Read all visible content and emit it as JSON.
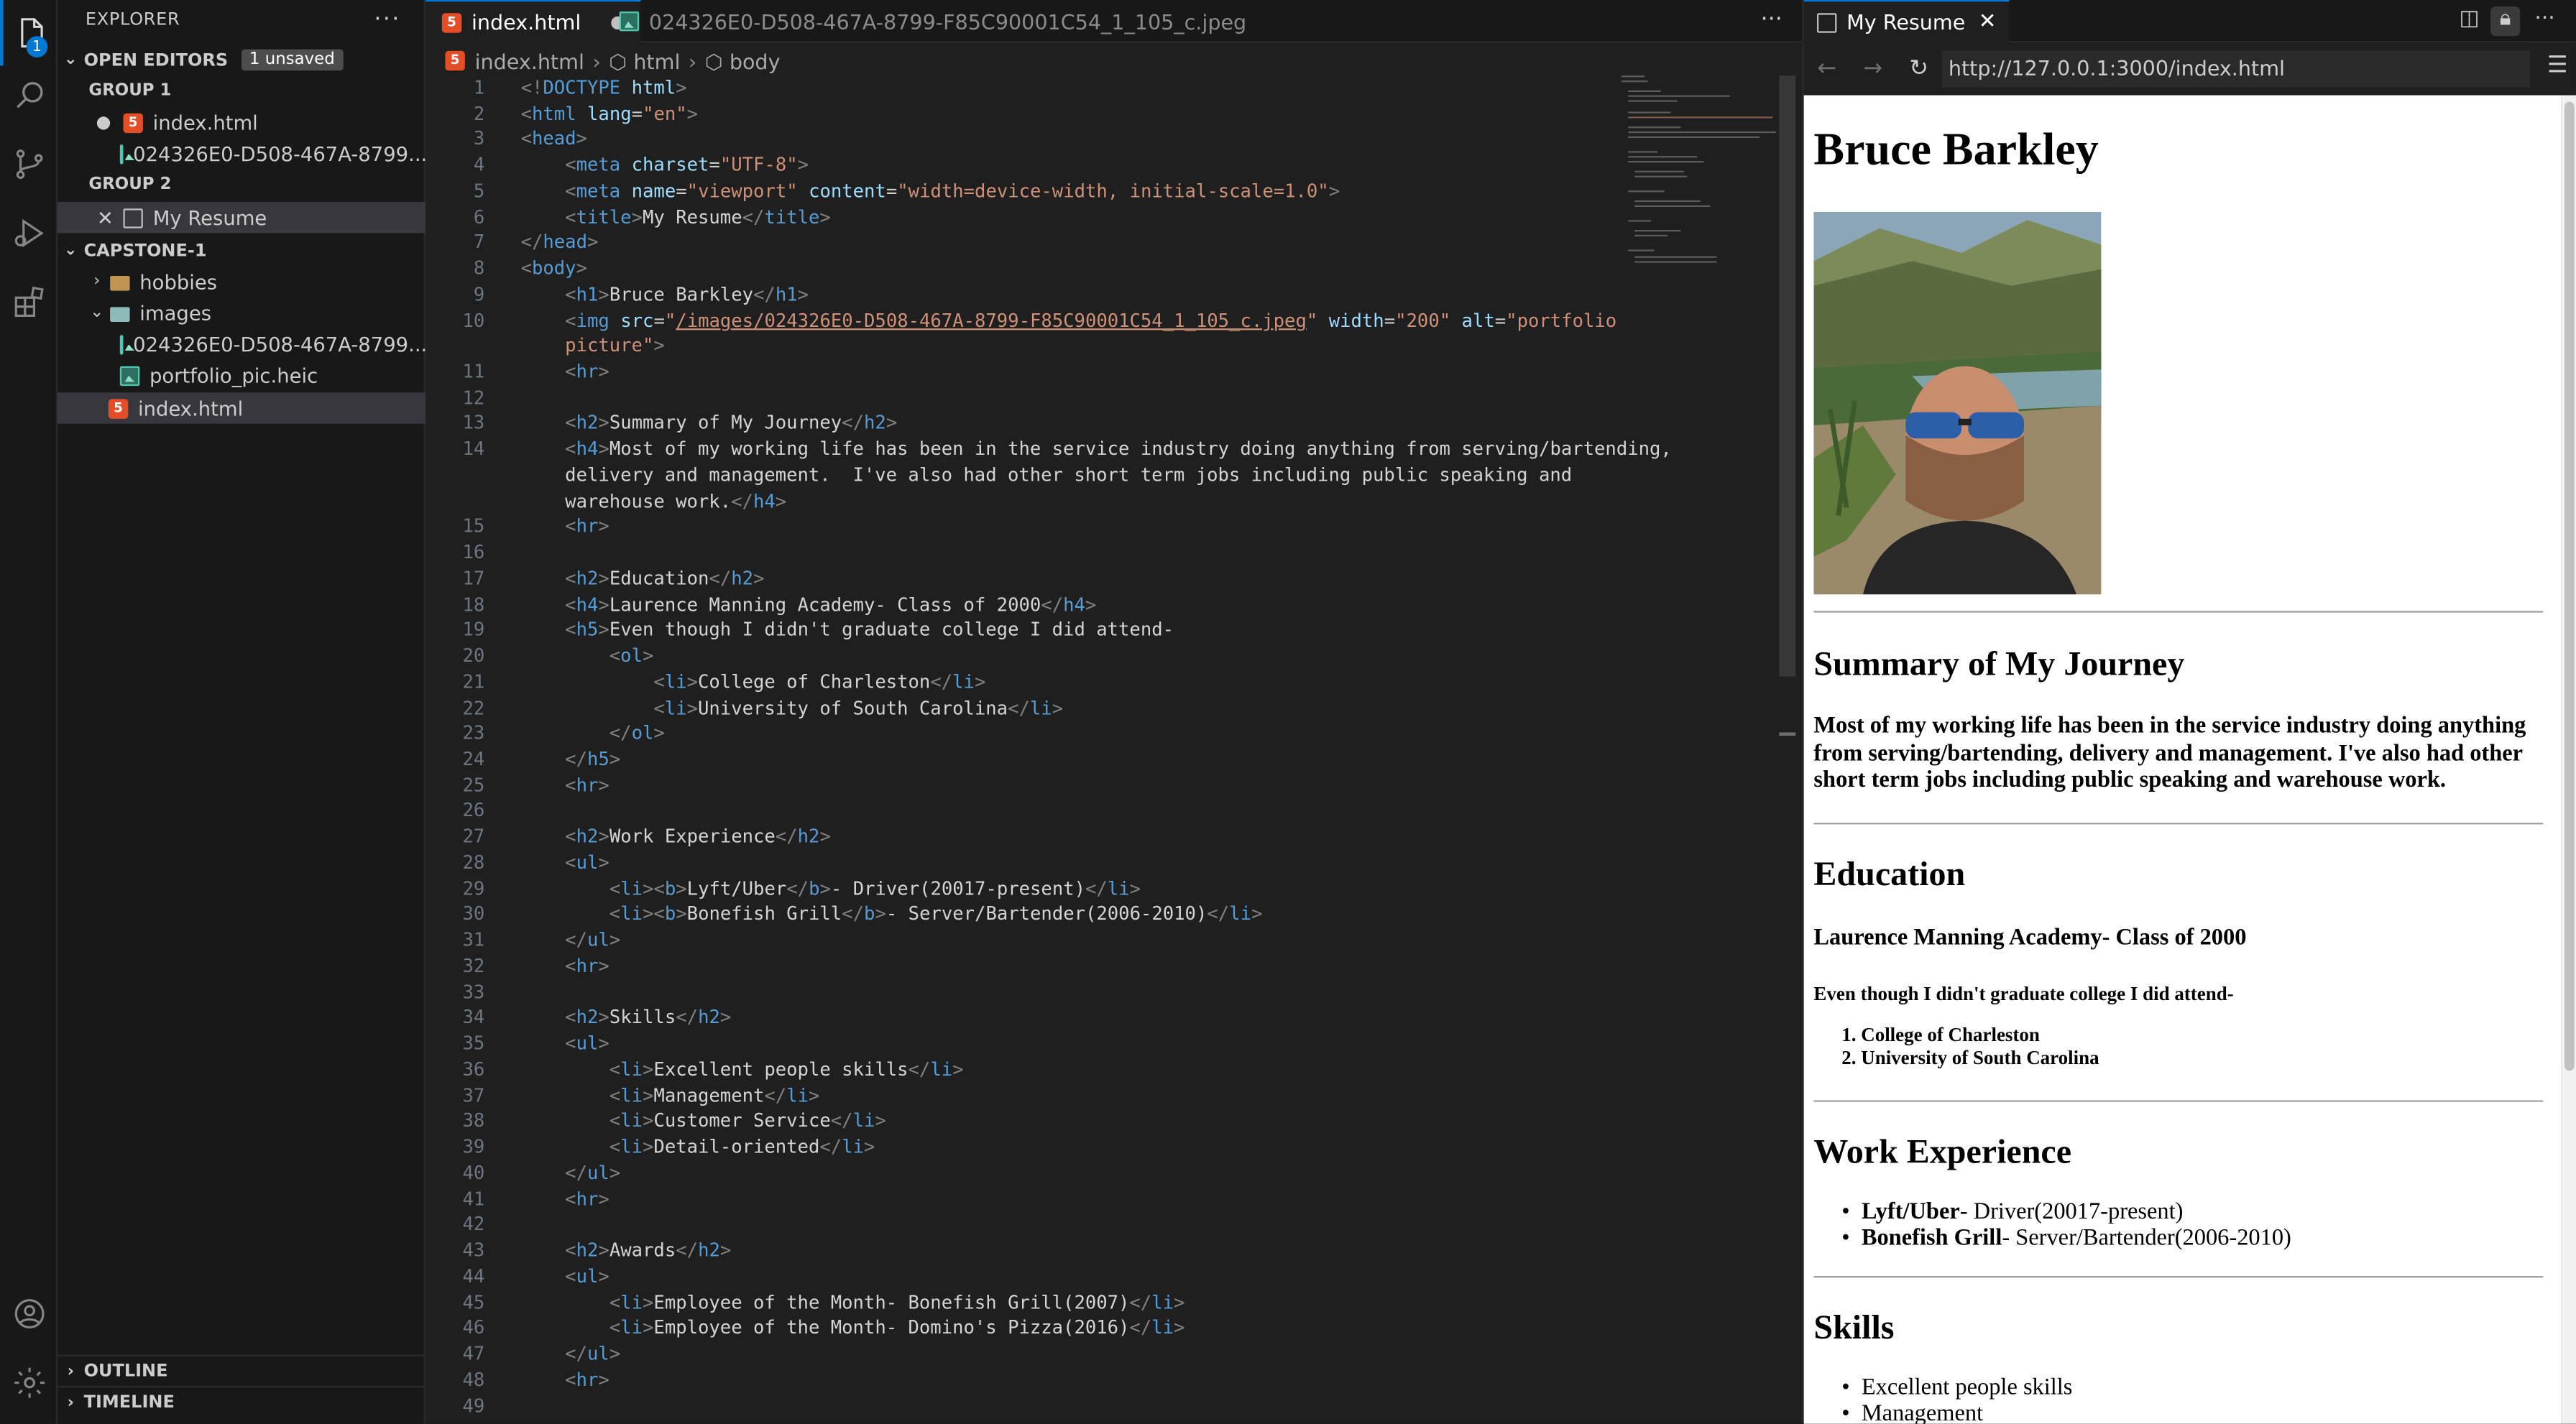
{
  "activity_bar": {
    "explorer_badge": "1"
  },
  "explorer": {
    "title": "EXPLORER",
    "open_editors": {
      "label": "OPEN EDITORS",
      "badge": "1 unsaved"
    },
    "groups": [
      {
        "label": "GROUP 1",
        "items": [
          "index.html",
          "024326E0-D508-467A-8799..."
        ]
      },
      {
        "label": "GROUP 2",
        "items": [
          "My Resume"
        ]
      }
    ],
    "project": {
      "label": "CAPSTONE-1",
      "items": [
        "hobbies",
        "images",
        "024326E0-D508-467A-8799...",
        "portfolio_pic.heic",
        "index.html"
      ]
    },
    "outline": "OUTLINE",
    "timeline": "TIMELINE"
  },
  "editor": {
    "tabs": [
      "index.html",
      "024326E0-D508-467A-8799-F85C90001C54_1_105_c.jpeg"
    ],
    "breadcrumb": [
      "index.html",
      "html",
      "body"
    ],
    "line_numbers": [
      "1",
      "2",
      "3",
      "4",
      "5",
      "6",
      "7",
      "8",
      "9",
      "10",
      "",
      "11",
      "12",
      "13",
      "14",
      "",
      "",
      "15",
      "16",
      "17",
      "18",
      "19",
      "20",
      "21",
      "22",
      "23",
      "24",
      "25",
      "26",
      "27",
      "28",
      "29",
      "30",
      "31",
      "32",
      "33",
      "34",
      "35",
      "36",
      "37",
      "38",
      "39",
      "40",
      "41",
      "42",
      "43",
      "44",
      "45",
      "46",
      "47",
      "48",
      "49"
    ]
  },
  "preview": {
    "tab_title": "My Resume",
    "url": "http://127.0.0.1:3000/index.html",
    "page": {
      "name": "Bruce Barkley",
      "summary_heading": "Summary of My Journey",
      "summary_text": "Most of my working life has been in the service industry doing anything from serving/bartending, delivery and management. I've also had other short term jobs including public speaking and warehouse work.",
      "education_heading": "Education",
      "school": "Laurence Manning Academy- Class of 2000",
      "college_note": "Even though I didn't graduate college I did attend-",
      "colleges": [
        "College of Charleston",
        "University of South Carolina"
      ],
      "work_heading": "Work Experience",
      "jobs": [
        {
          "employer": "Lyft/Uber",
          "role": "- Driver(20017-present)"
        },
        {
          "employer": "Bonefish Grill",
          "role": "- Server/Bartender(2006-2010)"
        }
      ],
      "skills_heading": "Skills",
      "skills": [
        "Excellent people skills",
        "Management"
      ]
    }
  }
}
